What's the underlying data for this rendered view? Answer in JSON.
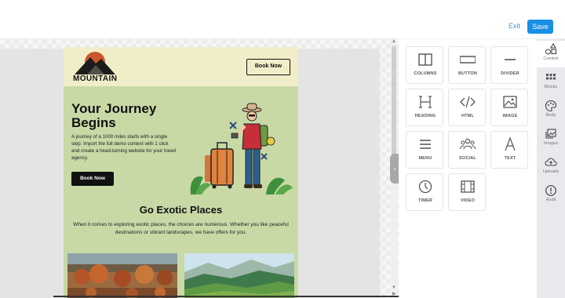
{
  "toolbar": {
    "exit_label": "Exit",
    "save_label": "Save"
  },
  "email": {
    "logo_text": "MOUNTAIN",
    "header_button": "Book Now",
    "hero_title": "Your Journey Begins",
    "hero_text": "A journey of a 1000 miles starts with a single step. Import the full demo content with 1 click and create a head-turning website for your travel agency.",
    "hero_button": "Book Now",
    "section_title": "Go Exotic Places",
    "section_text": "When it comes to exploring exotic places, the choices are numerous. Whether you like peaceful destinations or vibrant landscapes, we have offers for you."
  },
  "tools": [
    {
      "label": "COLUMNS",
      "icon": "columns-icon"
    },
    {
      "label": "BUTTON",
      "icon": "button-icon"
    },
    {
      "label": "DIVIDER",
      "icon": "divider-icon"
    },
    {
      "label": "HEADING",
      "icon": "heading-icon"
    },
    {
      "label": "HTML",
      "icon": "html-code-icon"
    },
    {
      "label": "IMAGE",
      "icon": "image-icon"
    },
    {
      "label": "MENU",
      "icon": "menu-icon"
    },
    {
      "label": "SOCIAL",
      "icon": "social-icon"
    },
    {
      "label": "TEXT",
      "icon": "text-icon"
    },
    {
      "label": "TIMER",
      "icon": "timer-icon"
    },
    {
      "label": "VIDEO",
      "icon": "video-icon"
    }
  ],
  "nav": [
    {
      "label": "Content",
      "icon": "content-shapes-icon",
      "active": true
    },
    {
      "label": "Blocks",
      "icon": "blocks-grid-icon",
      "active": false
    },
    {
      "label": "Body",
      "icon": "palette-icon",
      "active": false
    },
    {
      "label": "Images",
      "icon": "images-icon",
      "active": false
    },
    {
      "label": "Uploads",
      "icon": "cloud-upload-icon",
      "active": false
    },
    {
      "label": "Audit",
      "icon": "alert-circle-icon",
      "active": false
    }
  ],
  "colors": {
    "save_button": "#1a8fe3",
    "email_header_bg": "#f1edc8",
    "email_body_bg": "#c8d9a6",
    "nav_bg": "#e8e9ec"
  }
}
